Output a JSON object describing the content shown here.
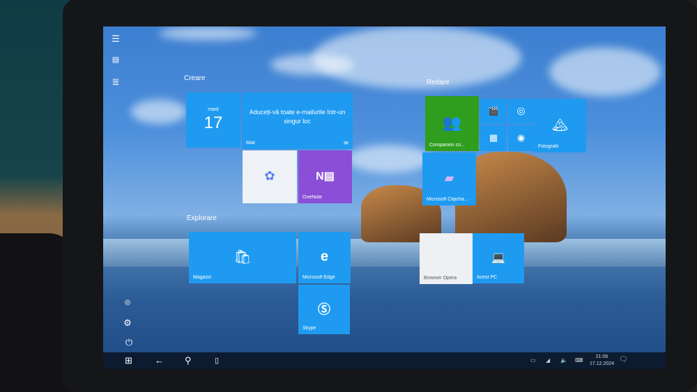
{
  "rail": {
    "icons": [
      "hamburger-menu-icon",
      "tiles-view-icon",
      "all-apps-list-icon",
      "user-icon",
      "settings-icon",
      "power-icon"
    ]
  },
  "groups": {
    "creare": "Creare",
    "explorare": "Explorare",
    "redare": "Redare"
  },
  "tiles": {
    "calendar": {
      "day": "marți",
      "date": "17"
    },
    "mail": {
      "message": "Aduceți-vă toate e-mailurile într-un singur loc",
      "label": "Mail"
    },
    "copilot": {
      "label": ""
    },
    "onenote": {
      "label": "OneNote"
    },
    "magazin": {
      "label": "Magazin"
    },
    "edge": {
      "label": "Microsoft Edge"
    },
    "skype": {
      "label": "Skype"
    },
    "companion": {
      "label": "Companion co..."
    },
    "fotografii": {
      "label": "Fotografii"
    },
    "clipchamp": {
      "label": "Microsoft Clipcha..."
    },
    "opera": {
      "label": "Browser Opera"
    },
    "acest_pc": {
      "label": "Acest PC"
    }
  },
  "colors": {
    "tile": "#1e9bf0",
    "xbox": "#2f9e1f",
    "onenote": "#8a4fd6",
    "taskbar": "#0c1b30"
  },
  "taskbar": {
    "time": "21:06",
    "date": "17.12.2024"
  }
}
